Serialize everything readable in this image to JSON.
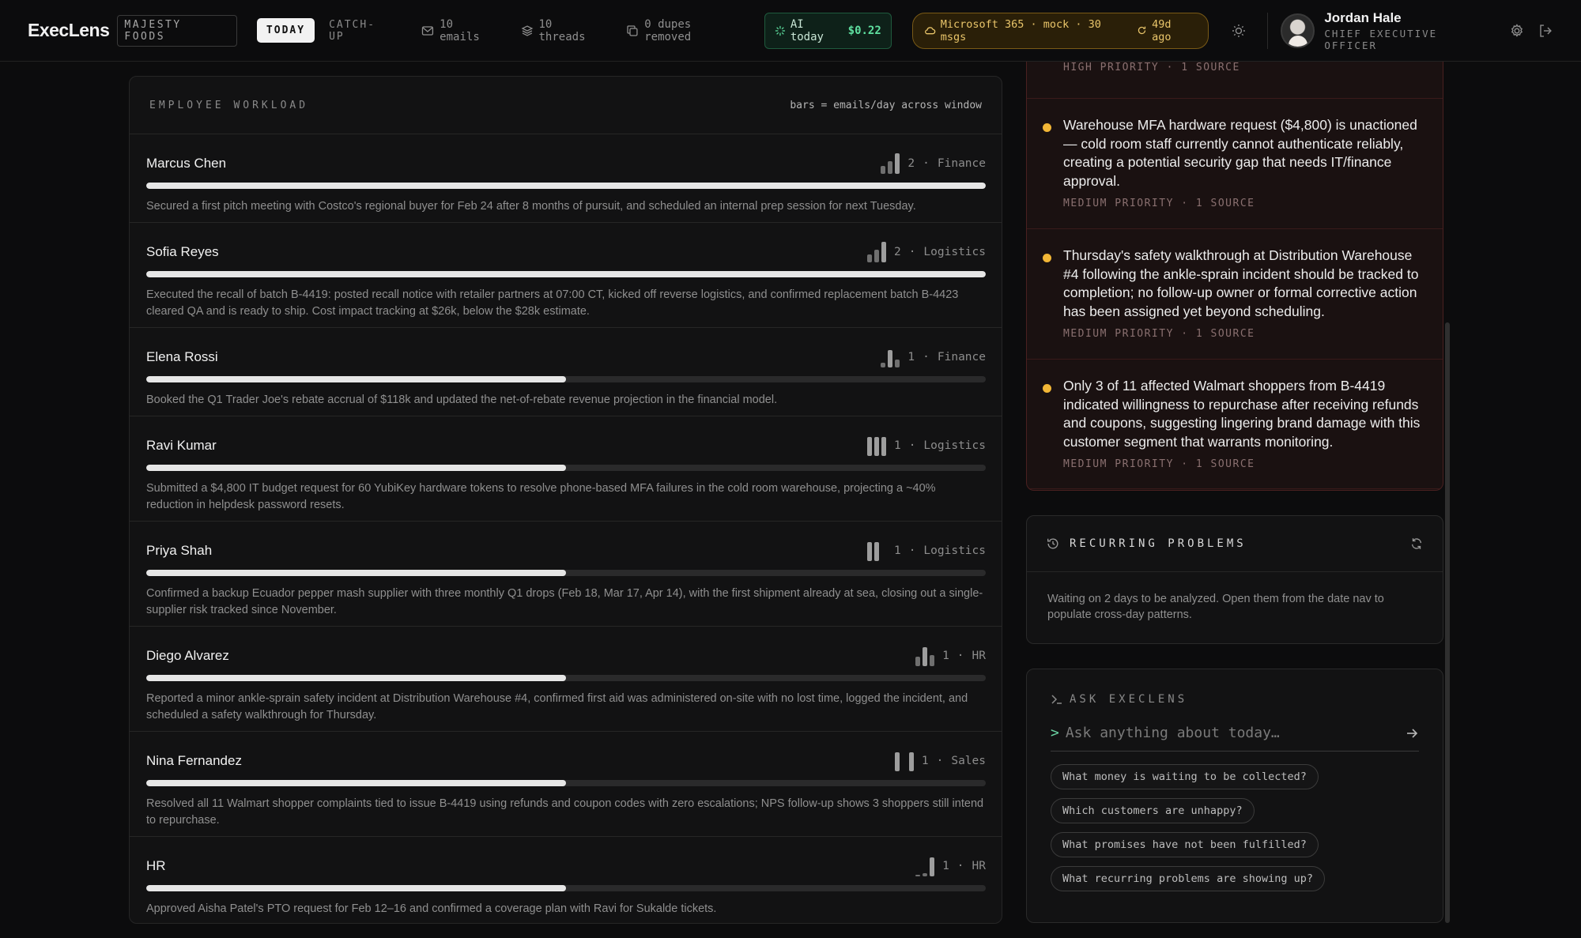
{
  "header": {
    "brand": "ExecLens",
    "company": "MAJESTY FOODS",
    "tabs": [
      {
        "label": "TODAY"
      },
      {
        "label": "CATCH-UP"
      }
    ],
    "stats": {
      "emails": "10 emails",
      "threads": "10 threads",
      "dupes": "0 dupes removed"
    },
    "ai": {
      "label": "AI today",
      "cost": "$0.22"
    },
    "source": {
      "label": "Microsoft 365 · mock · 30 msgs",
      "sync": "49d ago"
    },
    "user": {
      "name": "Jordan Hale",
      "role": "CHIEF EXECUTIVE OFFICER"
    }
  },
  "workload": {
    "title": "EMPLOYEE WORKLOAD",
    "note": "bars = emails/day across window",
    "employees": [
      {
        "name": "Marcus Chen",
        "count": "2",
        "dept": "Finance",
        "load": 1.0,
        "desc": "Secured a first pitch meeting with Costco's regional buyer for Feb 24 after 8 months of pursuit, and scheduled an internal prep session for next Tuesday."
      },
      {
        "name": "Sofia Reyes",
        "count": "2",
        "dept": "Logistics",
        "load": 1.0,
        "desc": "Executed the recall of batch B-4419: posted recall notice with retailer partners at 07:00 CT, kicked off reverse logistics, and confirmed replacement batch B-4423 cleared QA and is ready to ship. Cost impact tracking at $26k, below the $28k estimate."
      },
      {
        "name": "Elena Rossi",
        "count": "1",
        "dept": "Finance",
        "load": 0.5,
        "desc": "Booked the Q1 Trader Joe's rebate accrual of $118k and updated the net-of-rebate revenue projection in the financial model."
      },
      {
        "name": "Ravi Kumar",
        "count": "1",
        "dept": "Logistics",
        "load": 0.5,
        "desc": "Submitted a $4,800 IT budget request for 60 YubiKey hardware tokens to resolve phone-based MFA failures in the cold room warehouse, projecting a ~40% reduction in helpdesk password resets."
      },
      {
        "name": "Priya Shah",
        "count": "1",
        "dept": "Logistics",
        "load": 0.5,
        "desc": "Confirmed a backup Ecuador pepper mash supplier with three monthly Q1 drops (Feb 18, Mar 17, Apr 14), with the first shipment already at sea, closing out a single-supplier risk tracked since November."
      },
      {
        "name": "Diego Alvarez",
        "count": "1",
        "dept": "HR",
        "load": 0.5,
        "desc": "Reported a minor ankle-sprain safety incident at Distribution Warehouse #4, confirmed first aid was administered on-site with no lost time, logged the incident, and scheduled a safety walkthrough for Thursday."
      },
      {
        "name": "Nina Fernandez",
        "count": "1",
        "dept": "Sales",
        "load": 0.5,
        "desc": "Resolved all 11 Walmart shopper complaints tied to issue B-4419 using refunds and coupon codes with zero escalations; NPS follow-up shows 3 shoppers still intend to repurchase."
      },
      {
        "name": "HR",
        "count": "1",
        "dept": "HR",
        "load": 0.5,
        "desc": "Approved Aisha Patel's PTO request for Feb 12–16 and confirmed a coverage plan with Ravi for Sukalde tickets."
      }
    ]
  },
  "alerts": {
    "clipped_meta": "HIGH PRIORITY · 1 SOURCE",
    "items": [
      {
        "text": "Warehouse MFA hardware request ($4,800) is unactioned — cold room staff currently cannot authenticate reliably, creating a potential security gap that needs IT/finance approval.",
        "meta": "MEDIUM PRIORITY · 1 SOURCE"
      },
      {
        "text": "Thursday's safety walkthrough at Distribution Warehouse #4 following the ankle-sprain incident should be tracked to completion; no follow-up owner or formal corrective action has been assigned yet beyond scheduling.",
        "meta": "MEDIUM PRIORITY · 1 SOURCE"
      },
      {
        "text": "Only 3 of 11 affected Walmart shoppers from B-4419 indicated willingness to repurchase after receiving refunds and coupons, suggesting lingering brand damage with this customer segment that warrants monitoring.",
        "meta": "MEDIUM PRIORITY · 1 SOURCE"
      }
    ]
  },
  "recurring": {
    "title": "RECURRING PROBLEMS",
    "body": "Waiting on 2 days to be analyzed. Open them from the date nav to populate cross-day patterns."
  },
  "ask": {
    "title": "ASK EXECLENS",
    "prompt": ">",
    "placeholder": "Ask anything about today…",
    "suggestions": [
      "What money is waiting to be collected?",
      "Which customers are unhappy?",
      "What promises have not been fulfilled?",
      "What recurring problems are showing up?"
    ]
  },
  "colors": {
    "accent_green": "#5fe0a0",
    "warning_amber": "#f2b636",
    "alert_border": "#4a2020"
  }
}
